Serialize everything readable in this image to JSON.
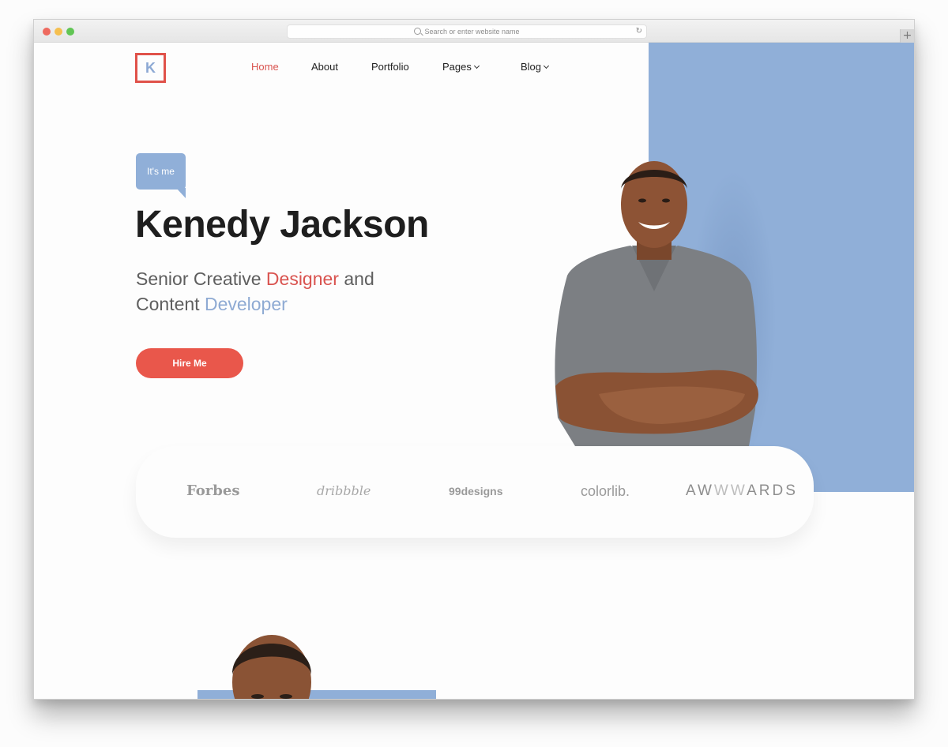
{
  "browser": {
    "url_placeholder": "Search or enter website name",
    "new_tab_label": "+"
  },
  "site": {
    "logo_letter": "K",
    "nav": [
      {
        "label": "Home",
        "active": true,
        "dropdown": false
      },
      {
        "label": "About",
        "active": false,
        "dropdown": false
      },
      {
        "label": "Portfolio",
        "active": false,
        "dropdown": false
      },
      {
        "label": "Pages",
        "active": false,
        "dropdown": true
      },
      {
        "label": "Blog",
        "active": false,
        "dropdown": true
      }
    ]
  },
  "hero": {
    "bubble": "It's me",
    "name": "Kenedy Jackson",
    "tagline": {
      "part1": "Senior Creative ",
      "highlight1": "Designer",
      "part2": " and",
      "part3": "Content ",
      "highlight2": "Developer"
    },
    "cta": "Hire Me"
  },
  "brands": {
    "forbes": "Forbes",
    "dribbble": "dribbble",
    "designs": "99designs",
    "colorlib": "colorlib.",
    "awwwards_a": "AW",
    "awwwards_ww": "WW",
    "awwwards_rest": "ARDS"
  },
  "colors": {
    "accent_red": "#e9574b",
    "accent_blue": "#90afd8",
    "text_dark": "#1e1e1e"
  }
}
